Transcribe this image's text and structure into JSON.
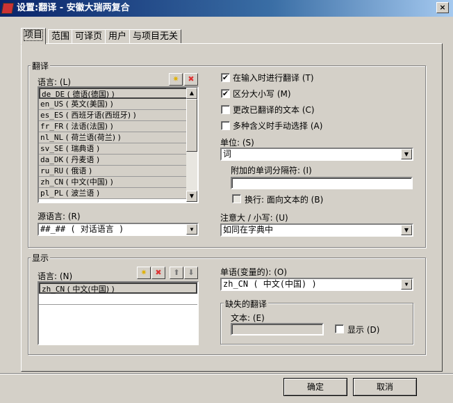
{
  "window": {
    "title": "设置:翻译 - 安徽大瑞两复合",
    "close": "×"
  },
  "tabs": [
    "项目",
    "范围",
    "可译页",
    "用户",
    "与项目无关"
  ],
  "translate_group": {
    "title": "翻译",
    "languages_label": "语言: (L)",
    "languages": [
      {
        "code": "de_DE",
        "name": "( 德语(德国) )"
      },
      {
        "code": "en_US",
        "name": "( 英文(美国) )"
      },
      {
        "code": "es_ES",
        "name": "( 西班牙语(西班牙) )"
      },
      {
        "code": "fr_FR",
        "name": "( 法语(法国) )"
      },
      {
        "code": "nl_NL",
        "name": "( 荷兰语(荷兰) )"
      },
      {
        "code": "sv_SE",
        "name": "( 瑞典语 )"
      },
      {
        "code": "da_DK",
        "name": "( 丹麦语 )"
      },
      {
        "code": "ru_RU",
        "name": "( 俄语 )"
      },
      {
        "code": "zh_CN",
        "name": "( 中文(中国) )"
      },
      {
        "code": "pl_PL",
        "name": "( 波兰语 )"
      }
    ],
    "source_label": "源语言: (R)",
    "source_value": "##_## ( 对话语言 )",
    "checkboxes": [
      {
        "label": "在输入时进行翻译 (T)",
        "checked": true
      },
      {
        "label": "区分大小写 (M)",
        "checked": true
      },
      {
        "label": "更改已翻译的文本 (C)",
        "checked": false
      },
      {
        "label": "多种含义时手动选择 (A)",
        "checked": false
      }
    ],
    "unit_label": "单位: (S)",
    "unit_value": "词",
    "separator_label": "附加的单词分隔符: (I)",
    "separator_value": "",
    "wrap_label": "换行: 面向文本的 (B)",
    "case_label": "注意大 / 小写: (U)",
    "case_value": "如同在字典中"
  },
  "display_group": {
    "title": "显示",
    "languages_label": "语言: (N)",
    "languages": [
      {
        "code": "zh_CN",
        "name": "( 中文(中国) )"
      }
    ],
    "single_label": "单语(变量的): (O)",
    "single_value": "zh_CN ( 中文(中国) )",
    "missing_title": "缺失的翻译",
    "text_label": "文本: (E)",
    "text_value": "",
    "show_label": "显示 (D)"
  },
  "buttons": {
    "ok": "确定",
    "cancel": "取消"
  }
}
